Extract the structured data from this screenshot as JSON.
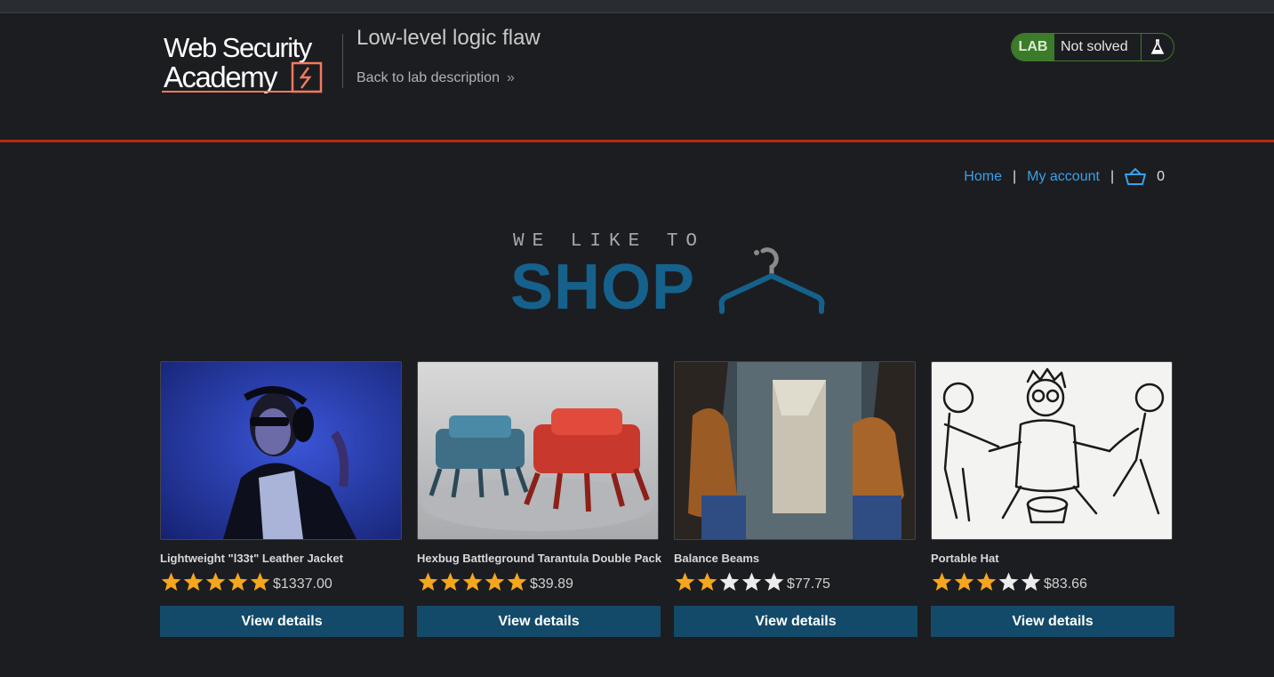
{
  "header": {
    "logo_text": [
      "Web Security",
      "Academy"
    ],
    "lab_title": "Low-level logic flaw",
    "back_link": "Back to lab description",
    "lab_label": "LAB",
    "lab_status": "Not solved"
  },
  "nav": {
    "home": "Home",
    "separator": "|",
    "my_account": "My account",
    "cart_count": "0"
  },
  "banner": {
    "tagline": "WE LIKE TO",
    "shop": "SHOP"
  },
  "colors": {
    "accent_red": "#b62a0f",
    "lab_green": "#3c7b2a",
    "link_blue": "#3aa0e8",
    "button_blue": "#134a69",
    "shop_blue": "#15618c",
    "star_gold": "#f5a61c"
  },
  "products": [
    {
      "name": "Lightweight \"l33t\" Leather Jacket",
      "rating": 5,
      "price": "$1337.00",
      "button": "View details"
    },
    {
      "name": "Hexbug Battleground Tarantula Double Pack",
      "rating": 5,
      "price": "$39.89",
      "button": "View details"
    },
    {
      "name": "Balance Beams",
      "rating": 2,
      "price": "$77.75",
      "button": "View details"
    },
    {
      "name": "Portable Hat",
      "rating": 3,
      "price": "$83.66",
      "button": "View details"
    }
  ]
}
